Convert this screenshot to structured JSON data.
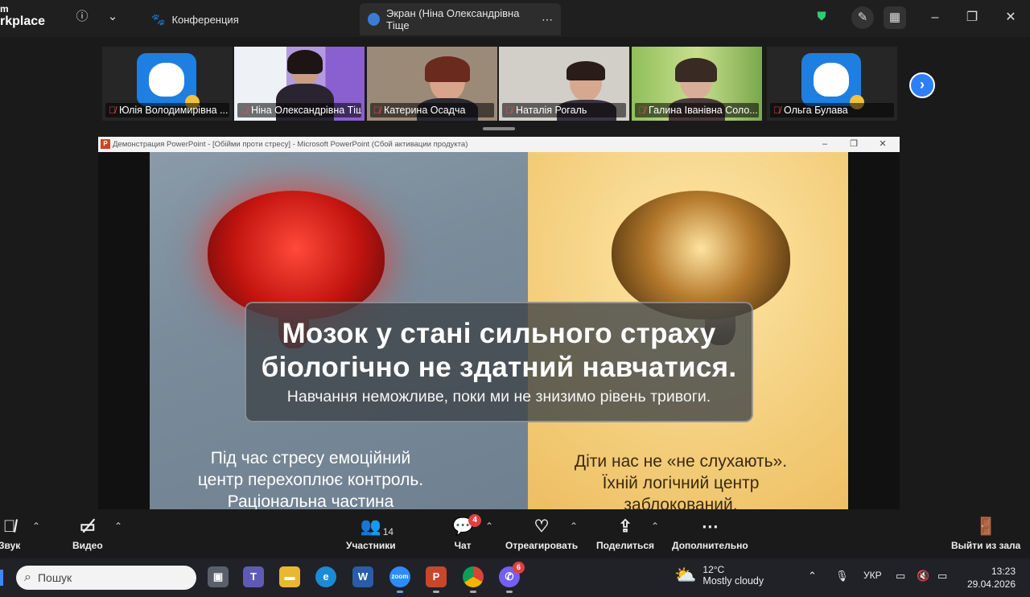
{
  "titlebar": {
    "brand_line1": "m",
    "brand_line2": "rkplace",
    "tabs": [
      {
        "label": "Конференция"
      },
      {
        "label": "Экран (Ніна Олександрівна Тіще"
      }
    ]
  },
  "participants": [
    {
      "name": "Юлія Володимирівна ..."
    },
    {
      "name": "Ніна Олександрівна Тіщ..."
    },
    {
      "name": "Катерина Осадча"
    },
    {
      "name": "Наталія Рогаль"
    },
    {
      "name": "Галина Іванівна Соло..."
    },
    {
      "name": "Ольга Булава"
    }
  ],
  "share": {
    "window_title": "Демонстрация PowerPoint - [Обійми проти стресу] - Microsoft PowerPoint (Сбой активации продукта)",
    "slide": {
      "headline_1": "Мозок у стані сильного страху",
      "headline_2": "біологічно не здатний навчатися.",
      "subline": "Навчання неможливе, поки ми не знизимо рівень тривоги.",
      "left_caption": [
        "Під час стресу емоційний",
        "центр перехоплює контроль.",
        "Раціональна частина"
      ],
      "right_caption": [
        "Діти нас не «не слухають».",
        "Їхній логічний центр",
        "заблокований."
      ]
    }
  },
  "toolbar": {
    "audio_label": "Звук",
    "video_label": "Видео",
    "participants_label": "Участники",
    "participants_count": "14",
    "chat_label": "Чат",
    "chat_badge": "4",
    "react_label": "Отреагировать",
    "share_label": "Поделиться",
    "more_label": "Дополнительно",
    "leave_label": "Выйти из зала"
  },
  "taskbar": {
    "search_placeholder": "Пошук",
    "viber_badge": "6",
    "weather_temp": "12°C",
    "weather_desc": "Mostly cloudy",
    "language": "УКР",
    "time": "13:23",
    "date": "29.04.2026"
  }
}
